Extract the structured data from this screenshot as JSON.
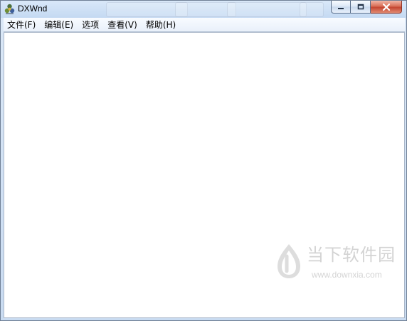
{
  "window": {
    "title": "DXWnd",
    "icons": {
      "app": "dxwnd-app-icon",
      "minimize": "minimize-icon",
      "maximize": "maximize-icon",
      "close": "close-icon"
    }
  },
  "menubar": {
    "items": [
      {
        "label": "文件(F)"
      },
      {
        "label": "编辑(E)"
      },
      {
        "label": "选项"
      },
      {
        "label": "查看(V)"
      },
      {
        "label": "帮助(H)"
      }
    ]
  },
  "content": {
    "state": "empty"
  },
  "watermark": {
    "title": "当下软件园",
    "url": "www.downxia.com",
    "icon": "downxia-logo-icon"
  }
}
